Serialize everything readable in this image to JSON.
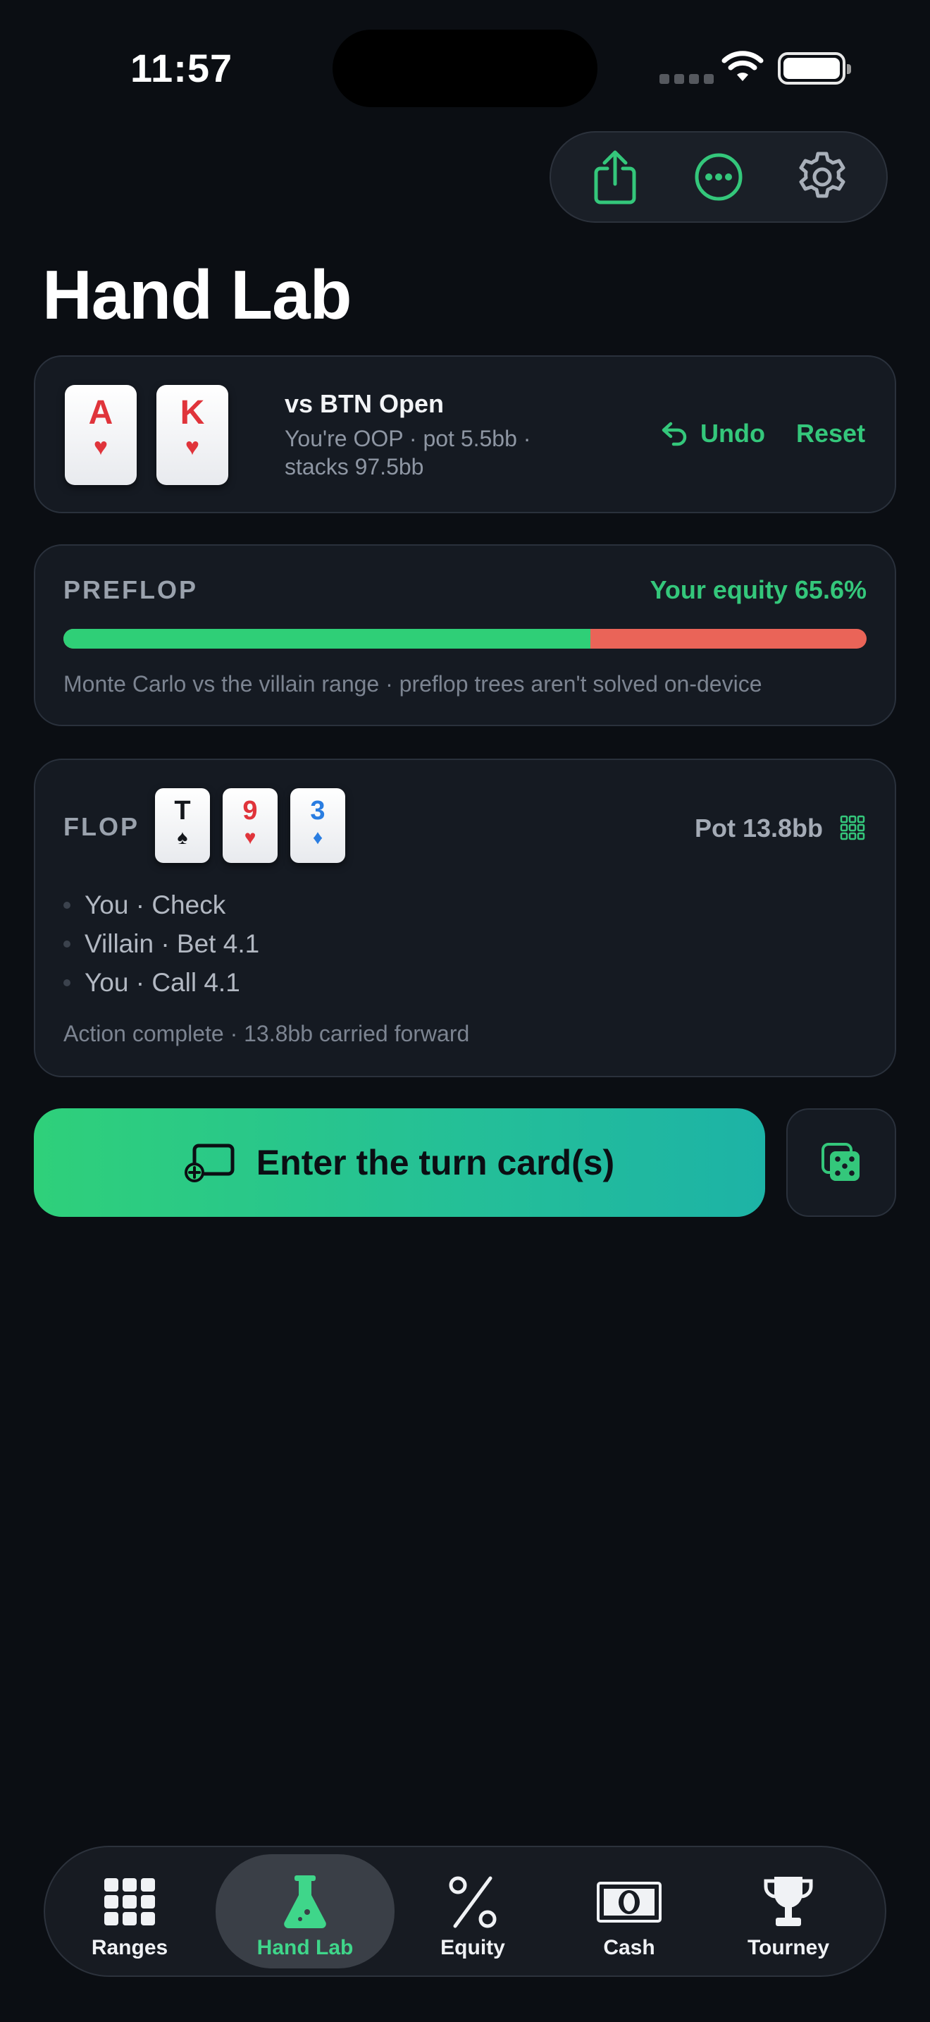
{
  "status_bar": {
    "time": "11:57"
  },
  "page": {
    "title": "Hand Lab"
  },
  "hand": {
    "cards": [
      {
        "rank": "A",
        "suit": "♥",
        "color": "red"
      },
      {
        "rank": "K",
        "suit": "♥",
        "color": "red"
      }
    ],
    "title": "vs BTN Open",
    "subtitle": "You're OOP · pot 5.5bb · stacks 97.5bb",
    "undo_label": "Undo",
    "reset_label": "Reset"
  },
  "preflop": {
    "label": "PREFLOP",
    "equity_text": "Your equity 65.6%",
    "equity_percent": 65.6,
    "note": "Monte Carlo vs the villain range · preflop trees aren't solved on-device",
    "colors": {
      "hero": "#2fcf77",
      "villain": "#ea6458"
    }
  },
  "flop": {
    "label": "FLOP",
    "cards": [
      {
        "rank": "T",
        "suit": "♠",
        "color": "black"
      },
      {
        "rank": "9",
        "suit": "♥",
        "color": "red"
      },
      {
        "rank": "3",
        "suit": "♦",
        "color": "blue"
      }
    ],
    "pot": "Pot 13.8bb",
    "actions": [
      "You · Check",
      "Villain · Bet 4.1",
      "You · Call 4.1"
    ],
    "summary": "Action complete · 13.8bb carried forward"
  },
  "cta": {
    "label": "Enter the turn card(s)"
  },
  "tabs": [
    {
      "label": "Ranges",
      "icon": "grid-icon",
      "active": false
    },
    {
      "label": "Hand Lab",
      "icon": "flask-icon",
      "active": true
    },
    {
      "label": "Equity",
      "icon": "percent-icon",
      "active": false
    },
    {
      "label": "Cash",
      "icon": "banknote-icon",
      "active": false
    },
    {
      "label": "Tourney",
      "icon": "trophy-icon",
      "active": false
    }
  ],
  "colors": {
    "accent": "#34c77b",
    "background": "#0b0e13",
    "card_bg": "#151a22"
  }
}
